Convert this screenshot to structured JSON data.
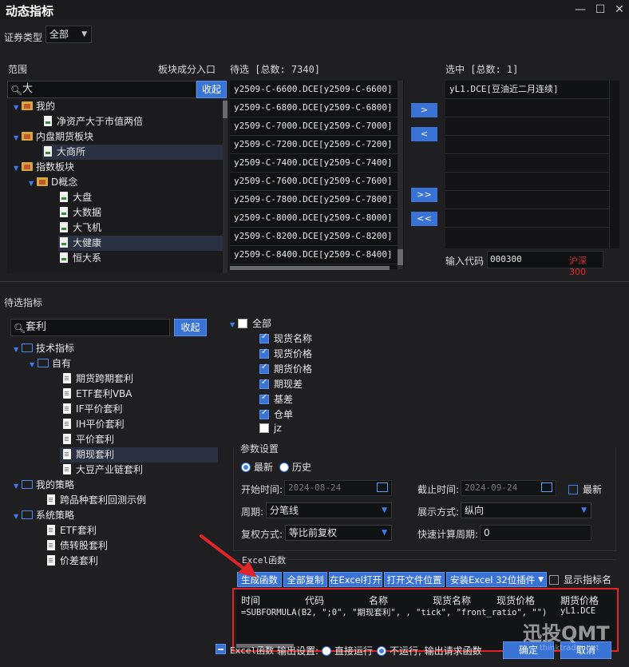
{
  "window": {
    "title": "动态指标",
    "controls": {
      "minimize": "—",
      "maximize": "☐",
      "close": "✕"
    }
  },
  "security_type": {
    "label": "证券类型",
    "value": "全部"
  },
  "range": {
    "label": "范围",
    "sector_import_label": "板块成分入口",
    "search_value": "大",
    "collapse_label": "收起",
    "tree": [
      {
        "label": "我的",
        "level": 0,
        "icon": "folder-gear",
        "expanded": true
      },
      {
        "label": "净资产大于市值两倍",
        "level": 2,
        "icon": "doc"
      },
      {
        "label": "内盘期货板块",
        "level": 0,
        "icon": "folder-gear",
        "expanded": true
      },
      {
        "label": "大商所",
        "level": 2,
        "icon": "doc",
        "selected": true
      },
      {
        "label": "指数板块",
        "level": 0,
        "icon": "folder-gear",
        "expanded": true
      },
      {
        "label": "D概念",
        "level": 1,
        "icon": "folder-gear",
        "expanded": true
      },
      {
        "label": "大盘",
        "level": 2,
        "icon": "doc"
      },
      {
        "label": "大数据",
        "level": 2,
        "icon": "doc"
      },
      {
        "label": "大飞机",
        "level": 2,
        "icon": "doc"
      },
      {
        "label": "大健康",
        "level": 2,
        "icon": "doc",
        "selected": true
      },
      {
        "label": "恒大系",
        "level": 2,
        "icon": "doc"
      }
    ]
  },
  "pending": {
    "label": "待选 [总数: 7340]",
    "items": [
      "y2509-C-6600.DCE[y2509-C-6600]",
      "y2509-C-6800.DCE[y2509-C-6800]",
      "y2509-C-7000.DCE[y2509-C-7000]",
      "y2509-C-7200.DCE[y2509-C-7200]",
      "y2509-C-7400.DCE[y2509-C-7400]",
      "y2509-C-7600.DCE[y2509-C-7600]",
      "y2509-C-7800.DCE[y2509-C-7800]",
      "y2509-C-8000.DCE[y2509-C-8000]",
      "y2509-C-8200.DCE[y2509-C-8200]",
      "y2509-C-8400.DCE[y2509-C-8400]"
    ]
  },
  "move_buttons": {
    "add": ">",
    "remove": "<",
    "add_all": ">>",
    "remove_all": "<<"
  },
  "selected": {
    "label": "选中 [总数: 1]",
    "items": [
      "yL1.DCE[豆油近二月连续]"
    ],
    "input_code_label": "输入代码",
    "input_code_value": "000300",
    "input_code_name": "沪深300"
  },
  "indicator": {
    "label": "待选指标",
    "search_value": "套利",
    "collapse_label": "收起",
    "tree": [
      {
        "label": "技术指标",
        "level": 0,
        "icon": "folder-blue"
      },
      {
        "label": "自有",
        "level": 1,
        "icon": "folder-blue"
      },
      {
        "label": "期货跨期套利",
        "level": 2,
        "icon": "doc-w"
      },
      {
        "label": "ETF套利VBA",
        "level": 2,
        "icon": "doc-w"
      },
      {
        "label": "IF平价套利",
        "level": 2,
        "icon": "doc-w"
      },
      {
        "label": "IH平价套利",
        "level": 2,
        "icon": "doc-w"
      },
      {
        "label": "平价套利",
        "level": 2,
        "icon": "doc-w"
      },
      {
        "label": "期现套利",
        "level": 2,
        "icon": "doc-w",
        "selected": true
      },
      {
        "label": "大豆产业链套利",
        "level": 2,
        "icon": "doc-w"
      },
      {
        "label": "我的策略",
        "level": 0,
        "icon": "folder-blue"
      },
      {
        "label": "跨品种套利回测示例",
        "level": 1,
        "icon": "doc-w"
      },
      {
        "label": "系统策略",
        "level": 0,
        "icon": "folder-blue"
      },
      {
        "label": "ETF套利",
        "level": 1,
        "icon": "doc-w"
      },
      {
        "label": "债转股套利",
        "level": 1,
        "icon": "doc-w"
      },
      {
        "label": "价差套利",
        "level": 1,
        "icon": "doc-w"
      }
    ]
  },
  "fields": {
    "all_label": "全部",
    "items": [
      {
        "label": "现货名称",
        "checked": true
      },
      {
        "label": "现货价格",
        "checked": true
      },
      {
        "label": "期货价格",
        "checked": true
      },
      {
        "label": "期现差",
        "checked": true
      },
      {
        "label": "基差",
        "checked": true
      },
      {
        "label": "仓单",
        "checked": true
      },
      {
        "label": "jz",
        "checked": false
      }
    ]
  },
  "params": {
    "label": "参数设置",
    "latest_label": "最新",
    "history_label": "历史",
    "start_label": "开始时间:",
    "start_value": "2024-08-24",
    "end_label": "截止时间:",
    "end_value": "2024-09-24",
    "end_latest_label": "最新",
    "period_label": "周期:",
    "period_value": "分笔线",
    "display_label": "展示方式:",
    "display_value": "纵向",
    "adjust_label": "复权方式:",
    "adjust_value": "等比前复权",
    "quick_label": "快速计算周期:",
    "quick_value": "0"
  },
  "excel": {
    "label": "Excel函数",
    "buttons": {
      "generate": "生成函数",
      "copy_all": "全部复制",
      "open_excel": "在Excel打开",
      "open_location": "打开文件位置",
      "install": "安装Excel 32位插件"
    },
    "show_name_label": "显示指标名",
    "header_cells": [
      "时间",
      "代码",
      "名称",
      "现货名称",
      "现货价格",
      "期货价格"
    ],
    "formula": "=SUBFORMULA(B2, \";0\", \"期现套利\", , \"tick\", \"front_ratio\", \"\")",
    "formula_code": "yL1.DCE"
  },
  "footer": {
    "excel_label": "Excel函数",
    "output_label": "输出设置:",
    "direct_run_label": "直接运行",
    "no_run_label": "不运行, 输出请求函数",
    "ok_label": "确定",
    "cancel_label": "取消"
  },
  "watermark": {
    "brand": "迅投QMT",
    "sub": "thinktrader.net"
  },
  "colors": {
    "accent": "#3a73d6",
    "highlight_box": "#e0242a",
    "code_red": "#e03030"
  }
}
